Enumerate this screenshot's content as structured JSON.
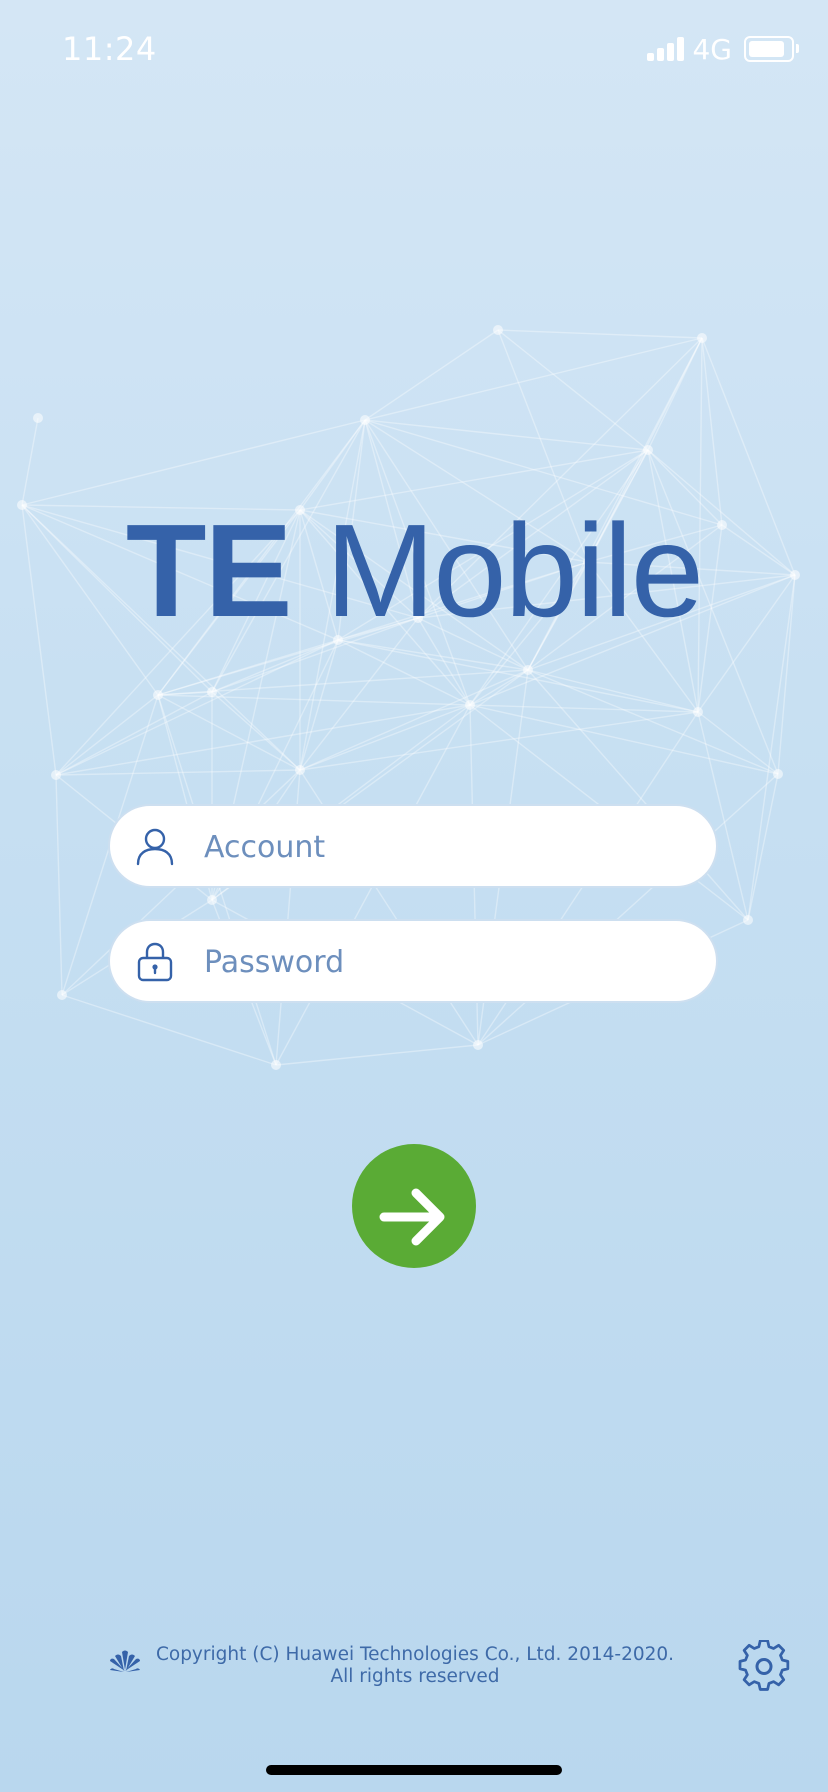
{
  "status_bar": {
    "time": "11:24",
    "network": "4G"
  },
  "logo": {
    "bold": "TE",
    "light": "Mobile"
  },
  "login_form": {
    "account_placeholder": "Account",
    "password_placeholder": "Password"
  },
  "footer": {
    "copyright": "Copyright (C) Huawei Technologies Co., Ltd. 2014-2020. All rights reserved"
  },
  "icons": {
    "account": "person-icon",
    "password": "lock-icon",
    "login": "arrow-right-icon",
    "brand": "huawei-logo-icon",
    "settings": "gear-icon"
  },
  "colors": {
    "brand_blue": "#3562a9",
    "login_green": "#5aab35",
    "background_top": "#d4e6f5",
    "background_bottom": "#b9d7ee"
  }
}
